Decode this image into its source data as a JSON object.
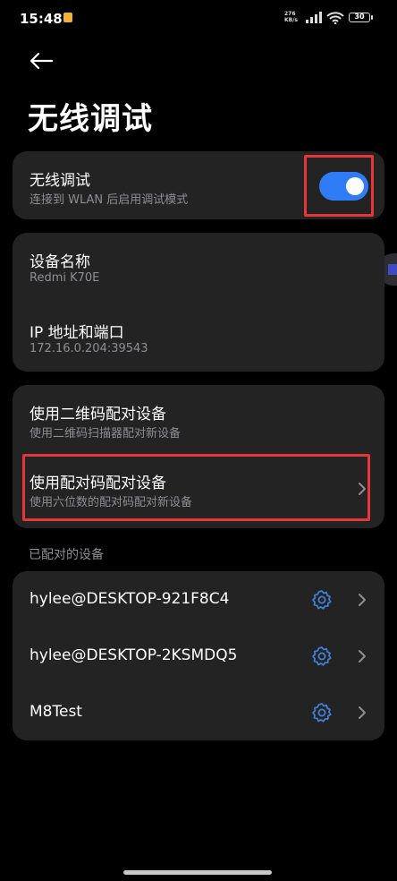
{
  "status_bar": {
    "time": "15:48",
    "network_speed_top": "276",
    "network_speed_bottom": "KB/s",
    "battery": "30"
  },
  "header": {
    "title": "无线调试"
  },
  "wireless_card": {
    "title": "无线调试",
    "subtitle": "连接到 WLAN 后启用调试模式",
    "toggle_on": true
  },
  "device_card": {
    "name_title": "设备名称",
    "name_value": "Redmi K70E",
    "ip_title": "IP 地址和端口",
    "ip_value": "172.16.0.204:39543"
  },
  "pair_card": {
    "qr_title": "使用二维码配对设备",
    "qr_subtitle": "使用二维码扫描器配对新设备",
    "code_title": "使用配对码配对设备",
    "code_subtitle": "使用六位数的配对码配对新设备"
  },
  "paired_section": {
    "label": "已配对的设备",
    "devices": [
      "hylee@DESKTOP-921F8C4",
      "hylee@DESKTOP-2KSMDQ5",
      "M8Test"
    ]
  },
  "colors": {
    "accent": "#2f7cf6",
    "highlight": "#e5373a",
    "card": "#232324",
    "gear": "#3f7fd8"
  }
}
